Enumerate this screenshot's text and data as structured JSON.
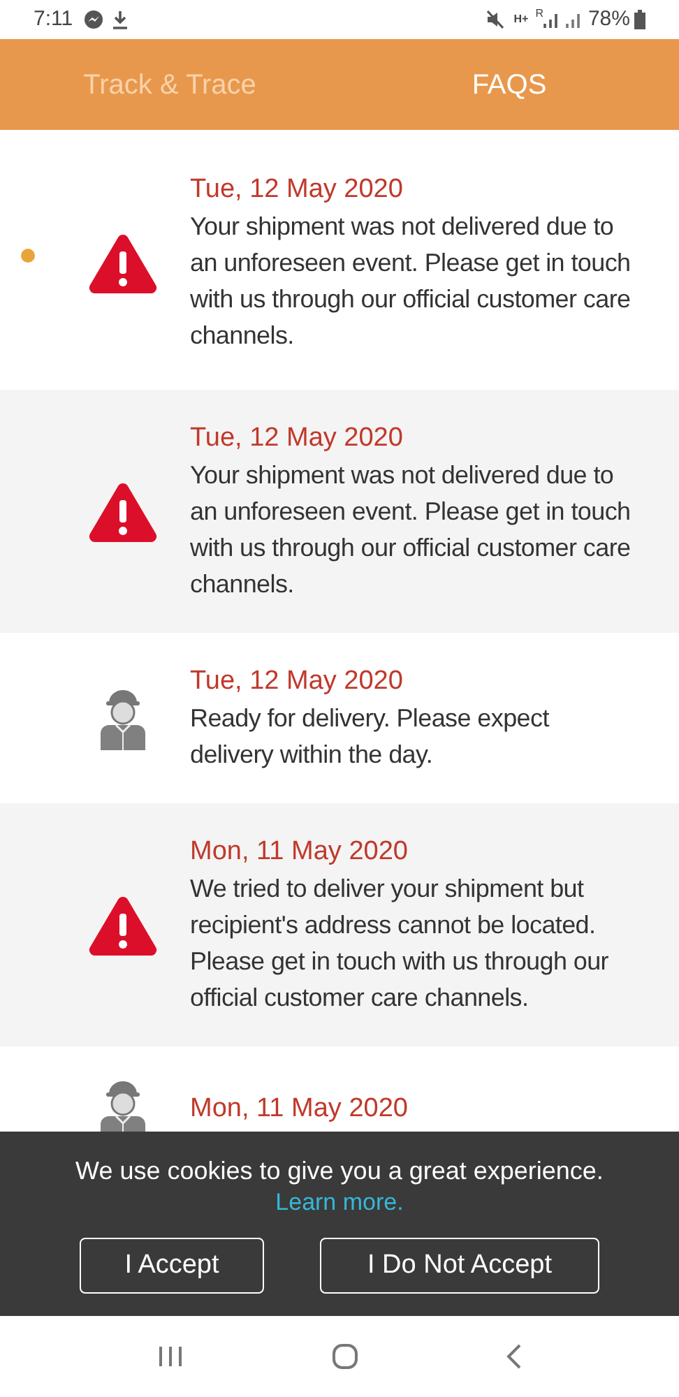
{
  "status_bar": {
    "time": "7:11",
    "network_type": "H+",
    "roaming": "R",
    "battery": "78%"
  },
  "tabs": [
    {
      "label": "Track & Trace",
      "selected": false
    },
    {
      "label": "FAQS",
      "selected": true
    }
  ],
  "events": [
    {
      "kind": "alert",
      "unread": true,
      "date": "Tue, 12 May 2020",
      "text": "Your shipment was not delivered due to an unforeseen event. Please get in touch with us through our official customer care channels."
    },
    {
      "kind": "alert",
      "unread": false,
      "date": "Tue, 12 May 2020",
      "text": "Your shipment was not delivered due to an unforeseen event. Please get in touch with us through our official customer care channels."
    },
    {
      "kind": "courier",
      "unread": false,
      "date": "Tue, 12 May 2020",
      "text": "Ready for delivery. Please expect delivery within the day."
    },
    {
      "kind": "alert",
      "unread": false,
      "date": "Mon, 11 May 2020",
      "text": "We tried to deliver your shipment but recipient's address cannot be located. Please get in touch with us through our official customer care channels."
    },
    {
      "kind": "courier",
      "unread": false,
      "date": "Mon, 11 May 2020"
    }
  ],
  "cookie_banner": {
    "message": "We use cookies to give you a great experience.",
    "link": "Learn more.",
    "buttons": [
      "I Accept",
      "I Do Not Accept"
    ]
  }
}
